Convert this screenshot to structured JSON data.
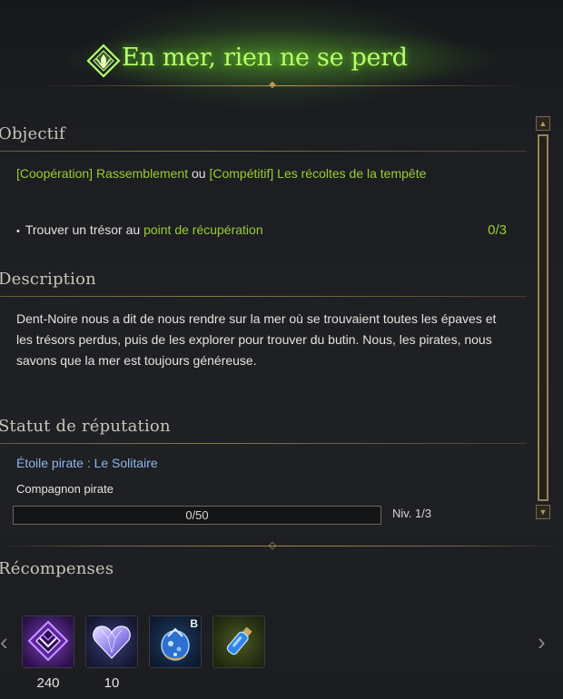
{
  "quest": {
    "title": "En mer, rien ne se perd"
  },
  "objective": {
    "heading": "Objectif",
    "coop_tag": "[Coopération] Rassemblement",
    "connector": " ou ",
    "comp_tag": "[Compétitif] Les récoltes de la tempête",
    "task_bullet": "•",
    "task_prefix": "Trouver un trésor au ",
    "task_link": "point de récupération",
    "task_progress": "0/3"
  },
  "description": {
    "heading": "Description",
    "text": "Dent-Noire nous a dit de nous rendre sur la mer où se trouvaient toutes les épaves et les trésors perdus, puis de les explorer pour trouver du butin. Nous, les pirates, nous savons que la mer est toujours généreuse."
  },
  "reputation": {
    "heading": "Statut de réputation",
    "faction": "Étoile pirate : Le Solitaire",
    "rank": "Compagnon pirate",
    "progress_text": "0/50",
    "progress_fraction": 0,
    "level": "Niv. 1/3"
  },
  "rewards": {
    "heading": "Récompenses",
    "prev_icon": "chevron-left-icon",
    "next_icon": "chevron-right-icon",
    "items": [
      {
        "icon": "purple-crest-emblem-icon",
        "count": "240",
        "grade": "",
        "bg": "#3a1f5c"
      },
      {
        "icon": "crystal-heart-icon",
        "count": "10",
        "grade": "",
        "bg": "#1d2340"
      },
      {
        "icon": "blue-gem-pouch-icon",
        "count": "",
        "grade": "B",
        "bg": "#14243c"
      },
      {
        "icon": "blue-potion-vial-icon",
        "count": "",
        "grade": "",
        "bg": "#2f3a16"
      }
    ]
  },
  "colors": {
    "title_green": "#b8ff70",
    "highlight_green": "#9acd32",
    "reputation_blue": "#8fb5e8",
    "gold_trim": "#b59a55"
  }
}
